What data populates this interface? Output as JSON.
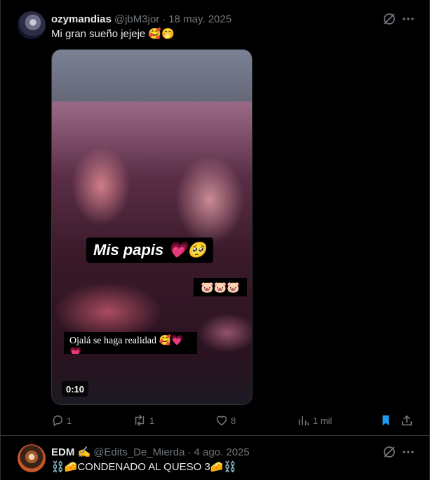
{
  "tweets": [
    {
      "author_name": "ozymandias",
      "handle": "@jbM3jor",
      "separator": "·",
      "date": "18 may. 2025",
      "text": "Mi gran sueño jejeje 🥰🤭",
      "media": {
        "caption_main": "Mis papis 💗🥺",
        "caption_pigs": "🐷🐷🐷",
        "caption_bottom": "Ojalá se haga realidad 🥰💗💗",
        "duration": "0:10"
      },
      "actions": {
        "replies": "1",
        "retweets": "1",
        "likes": "8",
        "views": "1 mil"
      }
    },
    {
      "author_name": "EDM ✍️",
      "handle": "@Edits_De_Mierda",
      "separator": "·",
      "date": "4 ago. 2025",
      "text": "⛓️🧀CONDENADO AL QUESO 3🧀⛓️"
    }
  ],
  "icons": {
    "grok": "grok-icon",
    "more": "more-icon",
    "reply": "reply-icon",
    "retweet": "retweet-icon",
    "like": "like-icon",
    "views": "views-icon",
    "bookmark": "bookmark-icon",
    "share": "share-icon"
  },
  "colors": {
    "background": "#000000",
    "text_primary": "#e7e9ea",
    "text_secondary": "#71767b",
    "border": "#2f3336",
    "bookmark_active": "#1d9bf0"
  }
}
